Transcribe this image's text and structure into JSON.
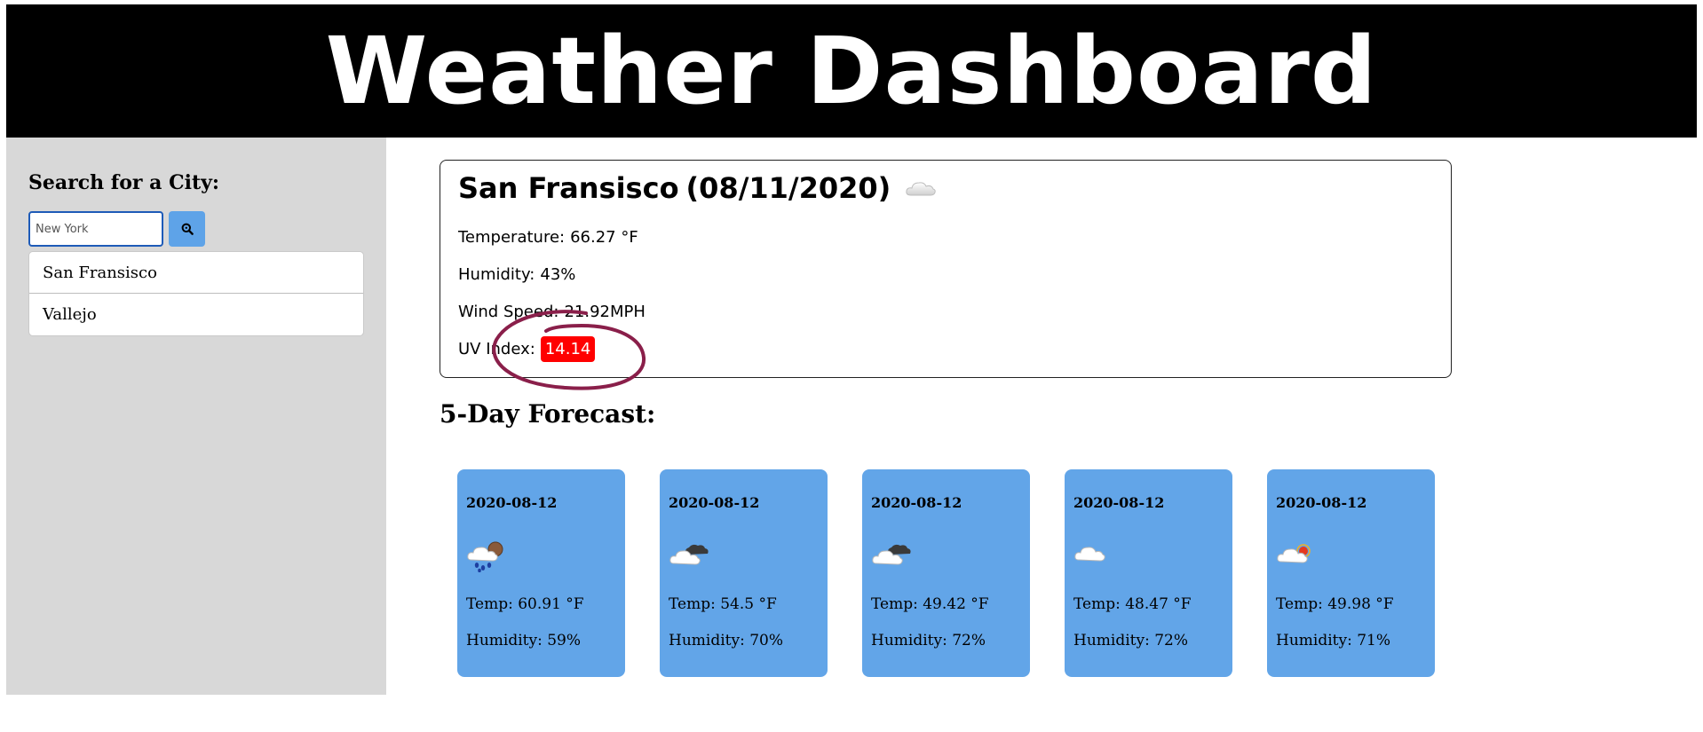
{
  "header": {
    "title": "Weather Dashboard"
  },
  "sidebar": {
    "heading": "Search for a City:",
    "search": {
      "value": "",
      "placeholder": "New York"
    },
    "search_button_icon": "search-icon",
    "cities": [
      {
        "label": "San Fransisco"
      },
      {
        "label": "Vallejo"
      }
    ]
  },
  "current": {
    "city": "San Fransisco",
    "date": "(08/11/2020)",
    "icon": "cloud-icon",
    "temperature_label": "Temperature:",
    "temperature": "66.27 °F",
    "humidity_label": "Humidity:",
    "humidity": "43%",
    "wind_label": "Wind Speed:",
    "wind": "21.92MPH",
    "uv_label": "UV Index:",
    "uv": "14.14",
    "uv_color": "#ff0000"
  },
  "forecast": {
    "heading": "5-Day Forecast:",
    "card_color": "#62a5e8",
    "days": [
      {
        "date": "2020-08-12",
        "icon": "rain-cloud-icon",
        "temp": "Temp: 60.91 °F",
        "humidity": "Humidity: 59%"
      },
      {
        "date": "2020-08-12",
        "icon": "broken-clouds-icon",
        "temp": "Temp: 54.5 °F",
        "humidity": "Humidity: 70%"
      },
      {
        "date": "2020-08-12",
        "icon": "broken-clouds-icon",
        "temp": "Temp: 49.42 °F",
        "humidity": "Humidity: 72%"
      },
      {
        "date": "2020-08-12",
        "icon": "cloud-icon",
        "temp": "Temp: 48.47 °F",
        "humidity": "Humidity: 72%"
      },
      {
        "date": "2020-08-12",
        "icon": "partly-cloudy-icon",
        "temp": "Temp: 49.98 °F",
        "humidity": "Humidity: 71%"
      }
    ]
  }
}
